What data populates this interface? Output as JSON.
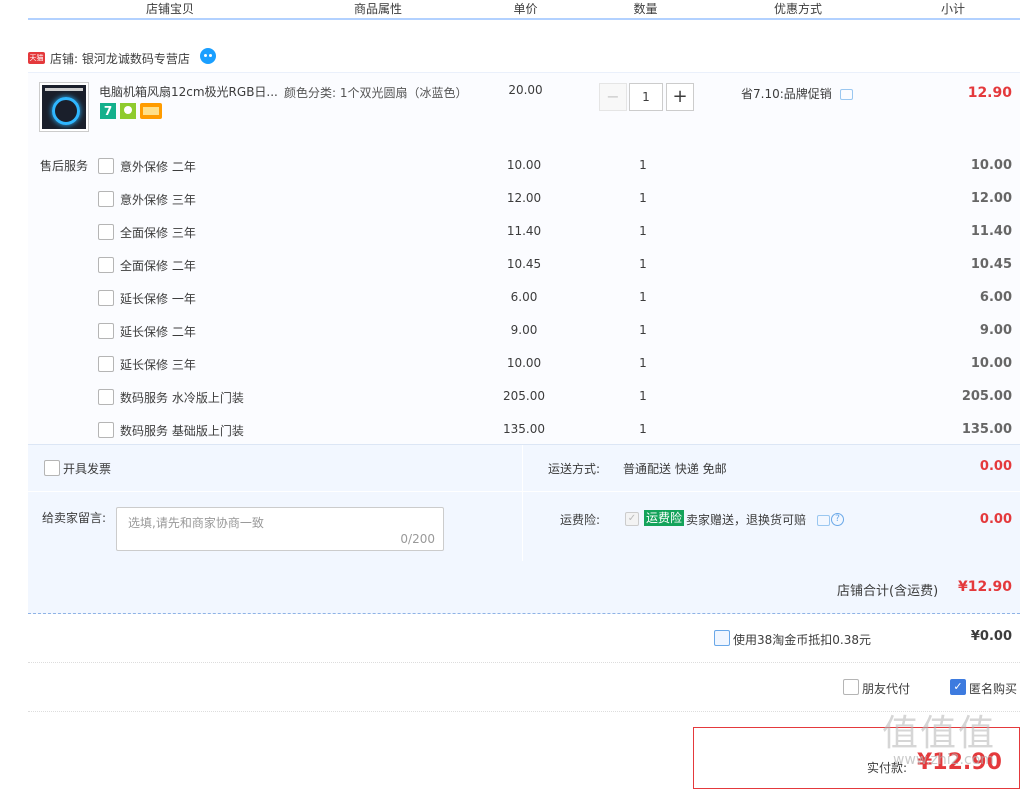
{
  "headers": [
    "店铺宝贝",
    "商品属性",
    "单价",
    "数量",
    "优惠方式",
    "小计"
  ],
  "shop": {
    "badge": "天猫",
    "label": "店铺: 银河龙诚数码专营店"
  },
  "item": {
    "title": "电脑机箱风扇12cm极光RGB日...",
    "tag_seven": "7",
    "attribute": "颜色分类: 1个双光圆扇（冰蓝色）",
    "price": "20.00",
    "qty_minus": "−",
    "quantity": "1",
    "qty_plus": "+",
    "promo": "省7.10:品牌促销",
    "subtotal": "12.90"
  },
  "services": {
    "label": "售后服务",
    "rows": [
      {
        "name": "意外保修 二年",
        "price": "10.00",
        "qty": "1",
        "subtotal": "10.00"
      },
      {
        "name": "意外保修 三年",
        "price": "12.00",
        "qty": "1",
        "subtotal": "12.00"
      },
      {
        "name": "全面保修 三年",
        "price": "11.40",
        "qty": "1",
        "subtotal": "11.40"
      },
      {
        "name": "全面保修 二年",
        "price": "10.45",
        "qty": "1",
        "subtotal": "10.45"
      },
      {
        "name": "延长保修 一年",
        "price": "6.00",
        "qty": "1",
        "subtotal": "6.00"
      },
      {
        "name": "延长保修 二年",
        "price": "9.00",
        "qty": "1",
        "subtotal": "9.00"
      },
      {
        "name": "延长保修 三年",
        "price": "10.00",
        "qty": "1",
        "subtotal": "10.00"
      },
      {
        "name": "数码服务 水冷版上门装",
        "price": "205.00",
        "qty": "1",
        "subtotal": "205.00"
      },
      {
        "name": "数码服务 基础版上门装",
        "price": "135.00",
        "qty": "1",
        "subtotal": "135.00"
      }
    ]
  },
  "order": {
    "invoice_label": "开具发票",
    "shipping_label": "运送方式:",
    "shipping_value": "普通配送 快递 免邮",
    "shipping_cost": "0.00",
    "message_label": "给卖家留言:",
    "message_placeholder": "选填,请先和商家协商一致",
    "message_counter": "0/200",
    "insurance_label": "运费险:",
    "insurance_tag": "运费险",
    "insurance_desc": "卖家赠送，退换货可赔",
    "insurance_help": "?",
    "insurance_cost": "0.00"
  },
  "shop_total": {
    "label": "店铺合计(含运费)",
    "value": "¥12.90"
  },
  "coins": {
    "label": "使用38淘金币抵扣0.38元",
    "value": "¥0.00"
  },
  "options": {
    "friend_pay": "朋友代付",
    "anonymous": "匿名购买",
    "anonymous_check": "✓"
  },
  "payment": {
    "label": "实付款:",
    "value": "¥12.90"
  },
  "watermark": {
    "main": "值值值",
    "sub": "www.zhi2.com"
  },
  "colors": {
    "accent_red": "#e4393c",
    "header_line": "#b2d1ff",
    "panel_bg": "#f2f7ff",
    "insurance_green": "#14a35a"
  }
}
